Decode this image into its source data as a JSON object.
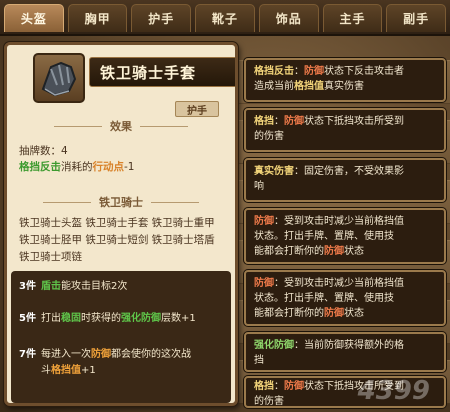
{
  "tabs": [
    "头盔",
    "胸甲",
    "护手",
    "靴子",
    "饰品",
    "主手",
    "副手"
  ],
  "active_tab": 0,
  "item": {
    "name": "铁卫骑士手套",
    "slot": "护手",
    "icon": "gauntlet-icon",
    "effect_title": "效果",
    "draw_label": "抽牌数：4",
    "effect_line_parts": [
      "格挡反击",
      "消耗的",
      "行动点",
      "-1"
    ],
    "set_title": "铁卫骑士",
    "set_pieces_lines": [
      "铁卫骑士头盔 铁卫骑士手套 铁卫骑士重甲",
      "铁卫骑士胫甲 铁卫骑士短剑 铁卫骑士塔盾",
      "铁卫骑士项链"
    ],
    "set_bonuses": [
      {
        "count": "3件",
        "parts": [
          "盾击",
          "能攻击目标2次"
        ]
      },
      {
        "count": "5件",
        "parts": [
          "打出",
          "稳固",
          "时获得的",
          "强化防御",
          "层数+1"
        ]
      },
      {
        "count": "7件",
        "parts": [
          "每进入一次",
          "防御",
          "都会使你的这次战",
          "斗",
          "格挡值",
          "+1"
        ]
      }
    ]
  },
  "tooltips": [
    {
      "key": "格挡反击",
      "sep": "：",
      "parts": [
        "防御",
        "状态下反击攻击者",
        "造成当前",
        "格挡值",
        "真实伤害"
      ]
    },
    {
      "key": "格挡",
      "sep": "：",
      "parts": [
        "防御",
        "状态下抵挡攻击所受到",
        "的伤害"
      ]
    },
    {
      "key": "真实伤害",
      "sep": "：",
      "parts": [
        "固定伤害，不受效果影",
        "响"
      ]
    },
    {
      "key": "防御",
      "sep": "：",
      "parts": [
        "受到攻击时减少当前格挡值",
        "状态。打出手牌、置牌、使用技",
        "能都会打断你的",
        "防御",
        "状态"
      ]
    },
    {
      "key": "防御",
      "sep": "：",
      "parts": [
        "受到攻击时减少当前格挡值",
        "状态。打出手牌、置牌、使用技",
        "能都会打断你的",
        "防御",
        "状态"
      ]
    },
    {
      "key": "强化防御",
      "sep": "：",
      "parts": [
        "当前防御获得额外的格",
        "挡"
      ]
    },
    {
      "key": "格挡",
      "sep": "：",
      "parts": [
        "防御",
        "状态下抵挡攻击所受到",
        "的伤害"
      ]
    }
  ],
  "watermark": "4399"
}
